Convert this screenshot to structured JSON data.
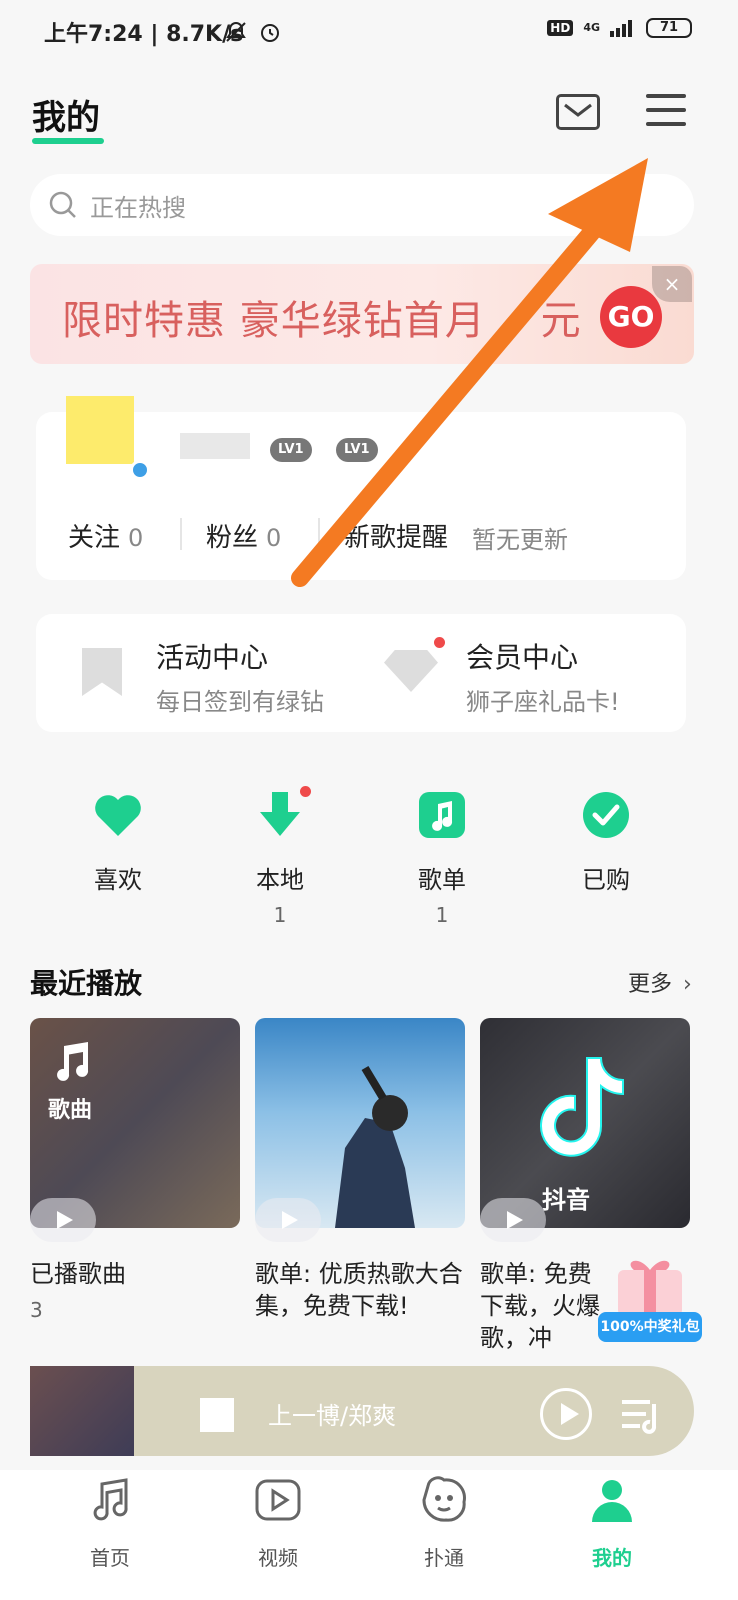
{
  "status_bar": {
    "time_network": "上午7:24 | 8.7K/s",
    "hd": "HD",
    "network": "4G",
    "battery": "71"
  },
  "header": {
    "title": "我的"
  },
  "search": {
    "placeholder": "正在热搜"
  },
  "banner": {
    "text": "限时特惠 豪华绿钻首月",
    "suffix": "元",
    "cta": "GO",
    "close": "×"
  },
  "profile": {
    "badges": [
      "LV1",
      "LV1"
    ],
    "stats": [
      {
        "label": "关注",
        "value": "0"
      },
      {
        "label": "粉丝",
        "value": "0"
      }
    ],
    "new_song_label": "新歌提醒",
    "new_song_status": "暂无更新"
  },
  "center": {
    "activity_title": "活动中心",
    "activity_sub": "每日签到有绿钻",
    "vip_title": "会员中心",
    "vip_sub": "狮子座礼品卡!"
  },
  "quick": [
    {
      "label": "喜欢",
      "count": ""
    },
    {
      "label": "本地",
      "count": "1"
    },
    {
      "label": "歌单",
      "count": "1"
    },
    {
      "label": "已购",
      "count": ""
    }
  ],
  "recent": {
    "title": "最近播放",
    "more": "更多",
    "tile1_tag": "歌曲",
    "tile3_logo": "抖音",
    "items": [
      {
        "caption": "已播歌曲",
        "sub": "3"
      },
      {
        "caption": "歌单: 优质热歌大合集，免费下载!"
      },
      {
        "caption": "歌单: 免费下载，火爆歌，冲"
      }
    ],
    "gift": "100%中奖礼包"
  },
  "player": {
    "title": "上一博/郑爽"
  },
  "nav": [
    {
      "label": "首页"
    },
    {
      "label": "视频"
    },
    {
      "label": "扑通"
    },
    {
      "label": "我的"
    }
  ],
  "colors": {
    "accent": "#1ecf8f",
    "arrow": "#f47a22"
  }
}
